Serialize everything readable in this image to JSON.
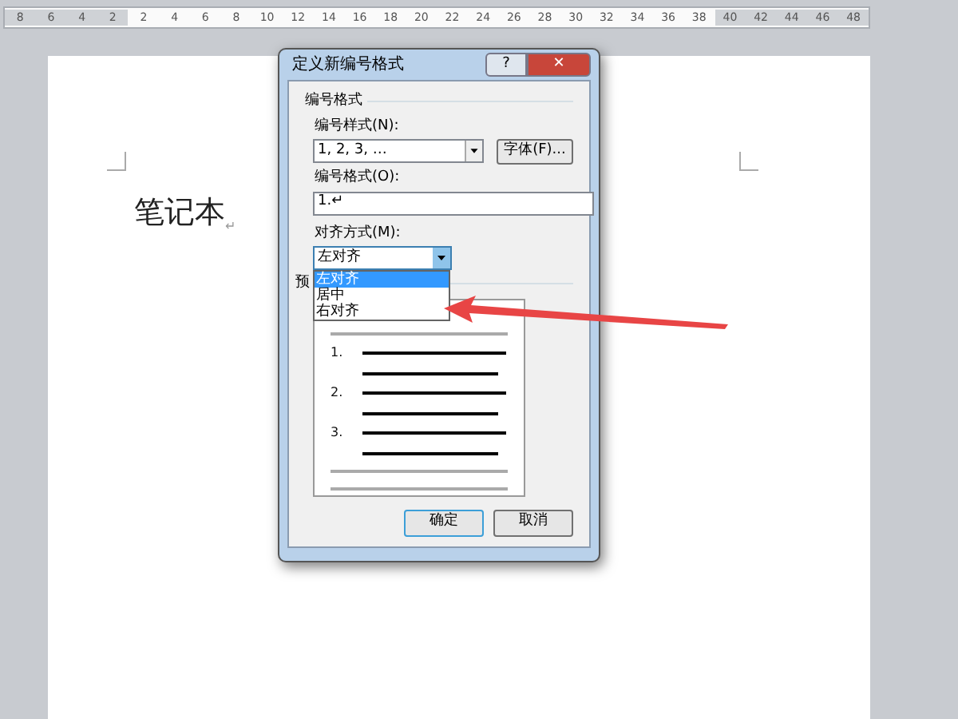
{
  "ruler": {
    "ticks": [
      "8",
      "6",
      "4",
      "2",
      "2",
      "4",
      "6",
      "8",
      "10",
      "12",
      "14",
      "16",
      "18",
      "20",
      "22",
      "24",
      "26",
      "28",
      "30",
      "32",
      "34",
      "36",
      "38",
      "40",
      "42",
      "44",
      "46",
      "48"
    ]
  },
  "document": {
    "text": "笔记本",
    "mark": "↵"
  },
  "dialog": {
    "title": "定义新编号格式",
    "help": "?",
    "close": "✕",
    "group": "编号格式",
    "style_label": "编号样式(N):",
    "style_value": "1, 2, 3, …",
    "font_button": "字体(F)...",
    "format_label": "编号格式(O):",
    "format_value": "1.↵",
    "align_label": "对齐方式(M):",
    "align_value": "左对齐",
    "dropdown_open": true,
    "align_options": [
      {
        "label": "左对齐",
        "selected": true
      },
      {
        "label": "居中",
        "selected": false
      },
      {
        "label": "右对齐",
        "selected": false
      }
    ],
    "preview_label": "预",
    "preview_numbers": [
      "1.",
      "2.",
      "3."
    ],
    "buttons": [
      {
        "label": "确定",
        "default": true
      },
      {
        "label": "取消",
        "default": false
      }
    ]
  }
}
